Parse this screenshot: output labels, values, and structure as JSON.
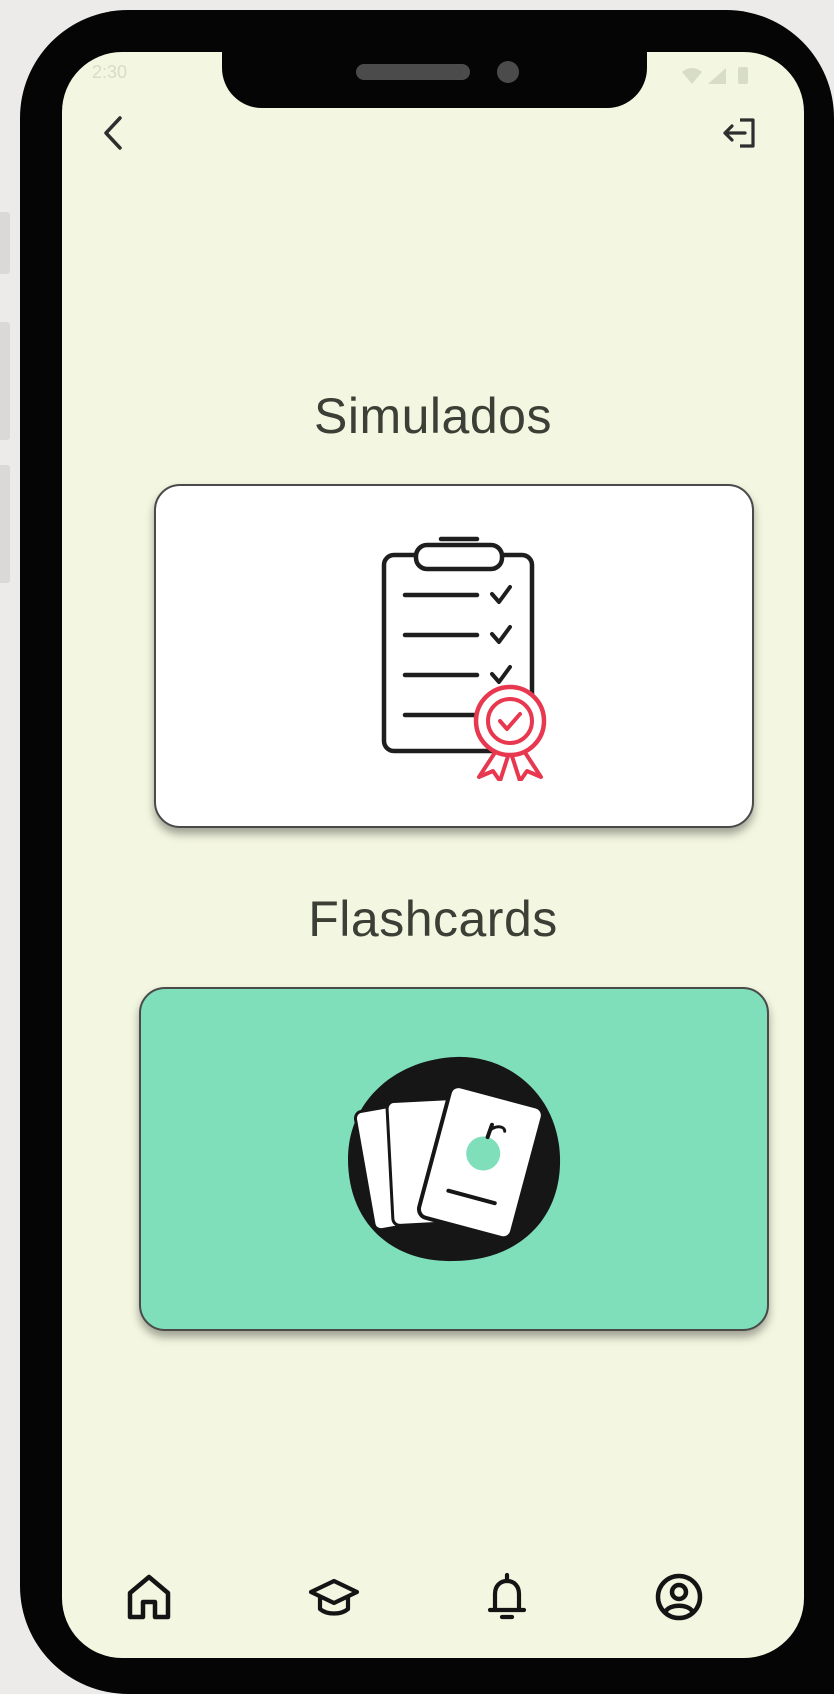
{
  "status_bar": {
    "time": "2:30",
    "icons": [
      "shield-icon",
      "sim-icon",
      "wifi-icon",
      "signal-icon",
      "battery-icon"
    ]
  },
  "header": {
    "back_icon": "chevron-left-icon",
    "logout_icon": "logout-icon"
  },
  "sections": [
    {
      "title": "Simulados",
      "illustration": "clipboard-certificate-icon",
      "card_color": "#ffffff"
    },
    {
      "title": "Flashcards",
      "illustration": "flashcards-apple-icon",
      "card_color": "#80dfbb"
    }
  ],
  "bottom_nav": {
    "items": [
      "home-icon",
      "graduation-cap-icon",
      "bell-icon",
      "profile-icon"
    ]
  },
  "colors": {
    "background": "#f3f6e0",
    "accent_green": "#80dfbb",
    "badge_red": "#e8384f",
    "frame": "#050505"
  }
}
